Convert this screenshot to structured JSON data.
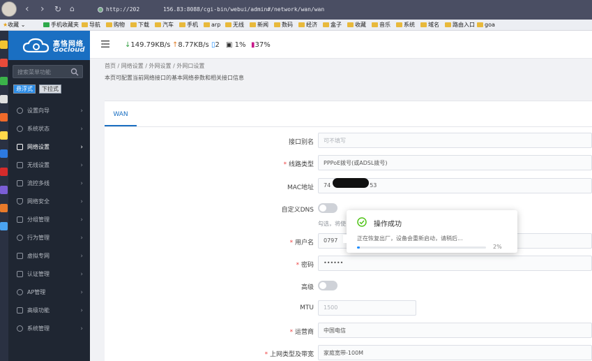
{
  "browser": {
    "url_part1": "http://202",
    "url_part2": "156.83:8088/cgi-bin/webui/admin#/network/wan/wan",
    "bookmarks": [
      "收藏",
      "手机收藏夹",
      "导航",
      "购物",
      "下载",
      "汽车",
      "手机",
      "arp",
      "无线",
      "新闻",
      "数码",
      "经济",
      "盒子",
      "收藏",
      "音乐",
      "系统",
      "域名",
      "路由入口",
      "goa"
    ]
  },
  "logo": {
    "name_cn": "高恪网络",
    "name_en": "Gocloud"
  },
  "sidebar": {
    "search_placeholder": "搜索菜单功能",
    "mode_float": "悬浮式",
    "mode_dropdown": "下拉式",
    "items": [
      {
        "label": "设置向导"
      },
      {
        "label": "系统状态"
      },
      {
        "label": "网络设置",
        "active": true
      },
      {
        "label": "无线设置"
      },
      {
        "label": "流控多线"
      },
      {
        "label": "网络安全"
      },
      {
        "label": "分组管理"
      },
      {
        "label": "行为管理"
      },
      {
        "label": "虚拟专网"
      },
      {
        "label": "认证管理"
      },
      {
        "label": "AP管理"
      },
      {
        "label": "高级功能"
      },
      {
        "label": "系统管理"
      }
    ]
  },
  "header": {
    "download": "149.79KB/s",
    "upload": "8.77KB/s",
    "devices": "2",
    "cpu": "1%",
    "memory": "37%"
  },
  "breadcrumb": "首页 / 网络设置 / 外网设置 / 外网口设置",
  "description": "本页可配置当前网络接口的基本网络参数和相关接口信息",
  "tab": "WAN",
  "form": {
    "alias_label": "接口别名",
    "alias_placeholder": "可不填写",
    "linktype_label": "线路类型",
    "linktype_value": "PPPoE拨号(或ADSL拨号)",
    "mac_label": "MAC地址",
    "mac_prefix": "74",
    "mac_suffix": "53",
    "dns_label": "自定义DNS",
    "dns_hint": "勾选，将使",
    "username_label": "用户名",
    "username_value": "0797",
    "password_label": "密码",
    "password_value": "••••••",
    "advanced_label": "高级",
    "mtu_label": "MTU",
    "mtu_placeholder": "1500",
    "isp_label": "运营商",
    "isp_value": "中国电信",
    "bandwidth_label": "上网类型及带宽",
    "bandwidth_value": "家庭宽带-100M"
  },
  "toast": {
    "title": "操作成功",
    "message": "正在恢复出厂，设备会重新启动，请稍后...",
    "progress": 0.02,
    "progress_text": "2%"
  },
  "colors": {
    "accent": "#1a6fc2",
    "success": "#52c41a",
    "required": "#ee4444",
    "sidebar_bg": "#1f2632"
  }
}
